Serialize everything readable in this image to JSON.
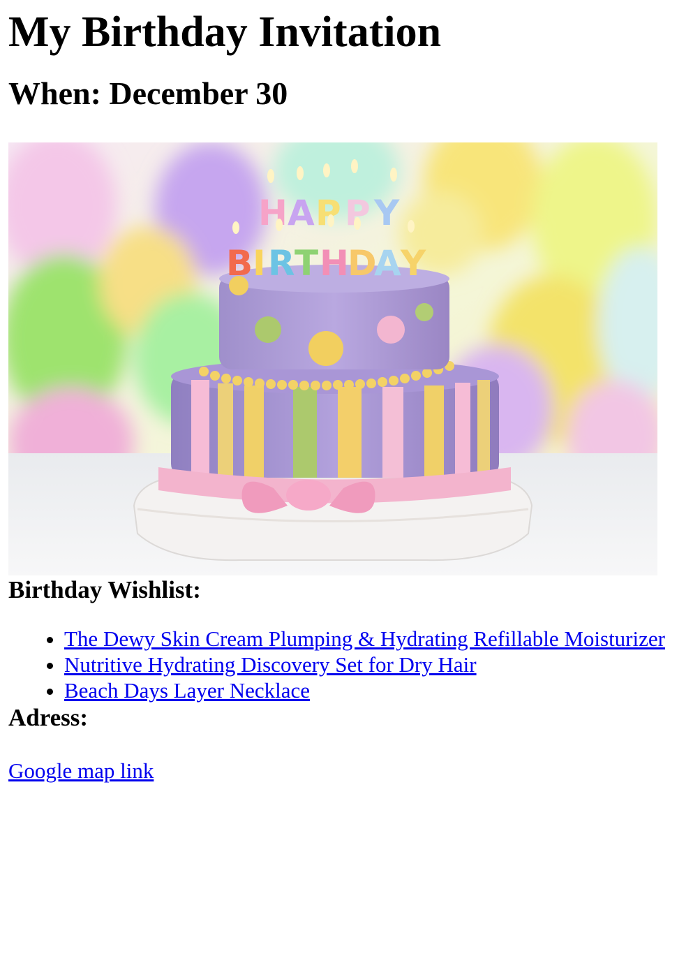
{
  "page": {
    "title": "My Birthday Invitation",
    "when": "When: December 30"
  },
  "image": {
    "description_icon": "birthday-cake-image",
    "candle_letters": "HAPPY BIRTHDAY"
  },
  "wishlist": {
    "heading": "Birthday Wishlist:",
    "items": [
      {
        "label": "The Dewy Skin Cream Plumping & Hydrating Refillable Moisturizer"
      },
      {
        "label": "Nutritive Hydrating Discovery Set for Dry Hair"
      },
      {
        "label": "Beach Days Layer Necklace"
      }
    ]
  },
  "address": {
    "heading": "Adress:",
    "link_label": "Google map link"
  },
  "colors": {
    "link": "#0000ee",
    "text": "#000000",
    "background": "#ffffff"
  }
}
